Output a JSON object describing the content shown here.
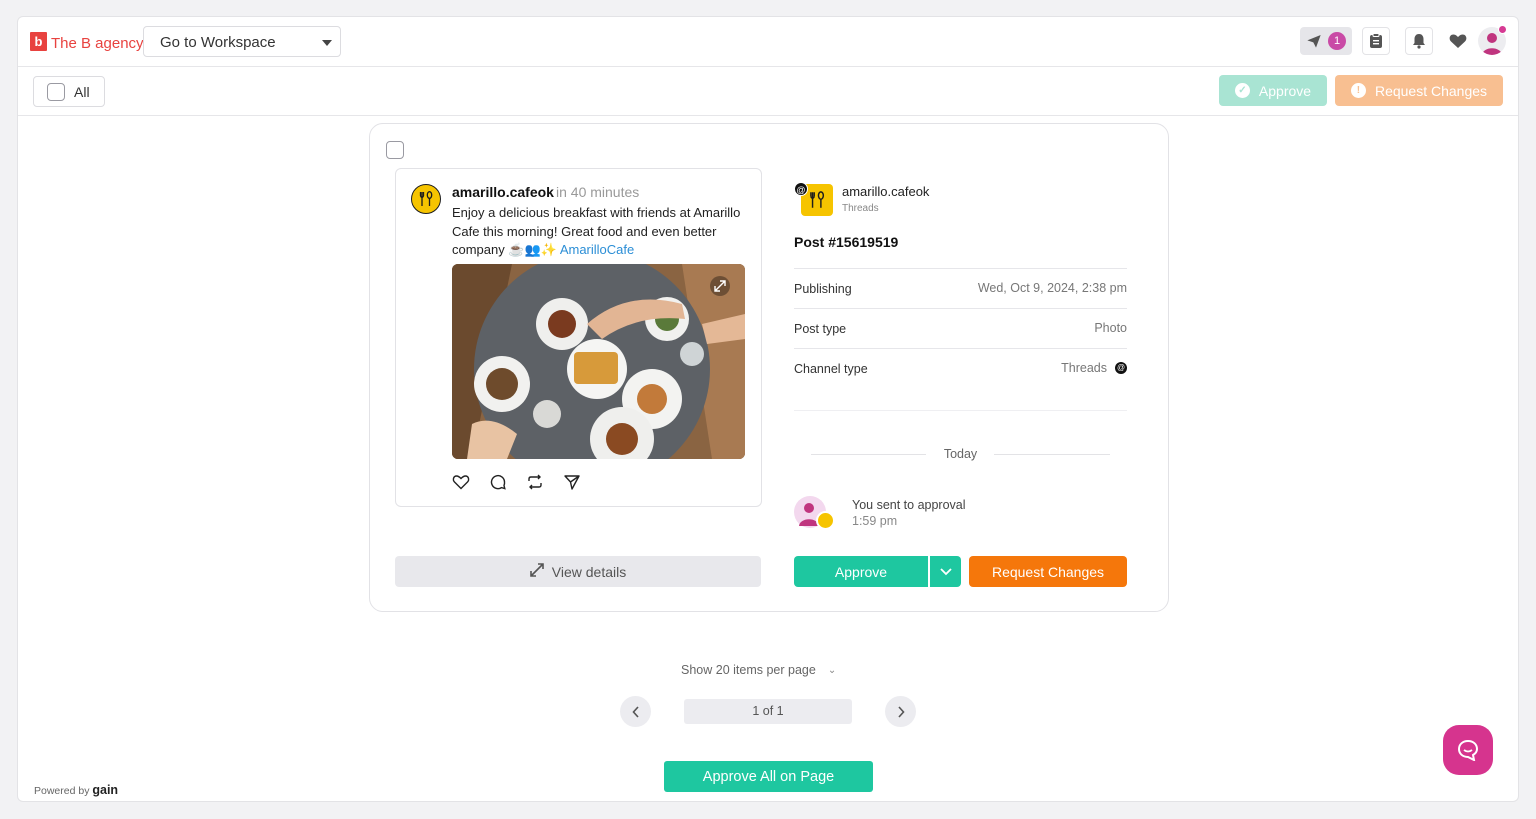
{
  "brand": {
    "mark": "b",
    "name": "The B agency",
    "color": "#e8423f"
  },
  "workspace_select": {
    "label": "Go to Workspace"
  },
  "topbar": {
    "send_count": "1"
  },
  "toolbar": {
    "all_label": "All",
    "approve_label": "Approve",
    "request_changes_label": "Request Changes"
  },
  "post": {
    "account": "amarillo.cafeok",
    "relative_time": "in 40 minutes",
    "text": "Enjoy a delicious breakfast with friends at Amarillo Cafe this morning! Great food and even better company ☕👥✨ ",
    "hashtag": "AmarilloCafe",
    "view_details_label": "View details"
  },
  "details": {
    "account": "amarillo.cafeok",
    "platform": "Threads",
    "post_id": "Post #15619519",
    "rows": [
      {
        "key": "Publishing",
        "value": "Wed, Oct 9, 2024, 2:38 pm"
      },
      {
        "key": "Post type",
        "value": "Photo"
      },
      {
        "key": "Channel type",
        "value": "Threads"
      }
    ],
    "day_label": "Today",
    "activity": {
      "title": "You sent to approval",
      "time": "1:59 pm"
    },
    "approve_label": "Approve",
    "request_changes_label": "Request Changes"
  },
  "pagination": {
    "per_page_label": "Show 20 items per page",
    "page_label": "1 of 1"
  },
  "approve_all_label": "Approve All on Page",
  "footer": {
    "powered_by": "Powered by",
    "brand": "gain"
  },
  "colors": {
    "approve": "#1ec7a0",
    "request": "#f5770b",
    "accent": "#d6348e"
  }
}
